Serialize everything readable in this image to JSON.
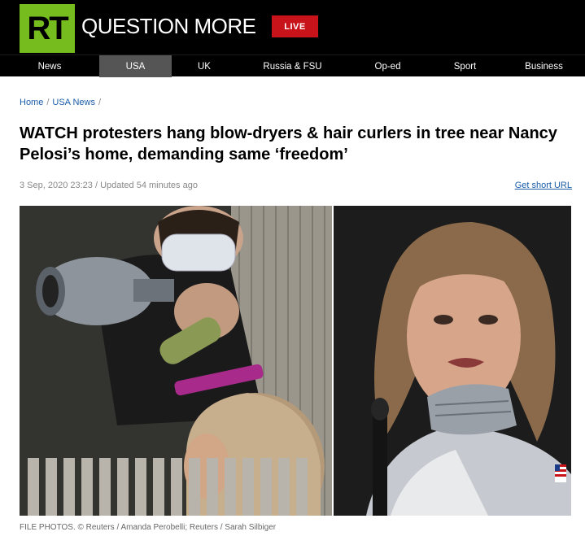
{
  "header": {
    "logo_text": "RT",
    "brand": "QUESTION MORE",
    "live_label": "LIVE"
  },
  "nav": {
    "items": [
      "News",
      "USA",
      "UK",
      "Russia & FSU",
      "Op-ed",
      "Sport",
      "Business"
    ],
    "active": "USA"
  },
  "breadcrumb": {
    "home": "Home",
    "section": "USA News"
  },
  "article": {
    "title": "WATCH protesters hang blow-dryers & hair curlers in tree near Nancy Pelosi’s home, demanding same ‘freedom’",
    "meta": "3 Sep, 2020 23:23 / Updated 54 minutes ago",
    "short_url_label": "Get short URL",
    "caption": "FILE PHOTOS. © Reuters / Amanda Perobelli; Reuters / Sarah Silbiger"
  }
}
